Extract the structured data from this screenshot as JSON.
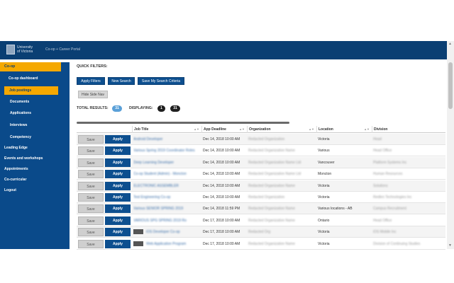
{
  "header": {
    "logo_line1": "University",
    "logo_line2": "of Victoria",
    "portal": "Co-op + Career Portal"
  },
  "sidebar": {
    "top": "Co-op",
    "subs": [
      "Co-op dashboard",
      "Job postings",
      "Documents",
      "Applications",
      "Interviews",
      "Competency"
    ],
    "items": [
      "Leading Edge",
      "Events and workshops",
      "Appointments",
      "Co-curricular",
      "Logout"
    ]
  },
  "filters": {
    "label": "QUICK FILTERS:",
    "apply": "Apply Filters",
    "new_search": "New Search",
    "save_criteria": "Save My Search Criteria",
    "hide_nav": "Hide Side Nav"
  },
  "totals": {
    "total_label": "TOTAL RESULTS:",
    "total_value": "31",
    "displaying_label": "DISPLAYING:",
    "displaying_from": "1",
    "displaying_to": "31"
  },
  "table": {
    "headers": [
      "Job Title",
      "App Deadline",
      "Organization",
      "Location",
      "Division"
    ],
    "save_label": "Save",
    "apply_label": "Apply",
    "rows": [
      {
        "title": "Android Developer",
        "deadline": "Dec 14, 2018 10:00 AM",
        "org": "Redacted Organization",
        "location": "Victoria",
        "division": "Head"
      },
      {
        "title": "Various Spring 2019 Coordinator Roles",
        "deadline": "Dec 14, 2018 10:00 AM",
        "org": "Redacted Organization Name",
        "location": "Various",
        "division": "Head Office"
      },
      {
        "title": "Deep Learning Developer",
        "deadline": "Dec 14, 2018 10:00 AM",
        "org": "Redacted Organization Name Ltd",
        "location": "Vancouver",
        "division": "Platform Systems Inc"
      },
      {
        "title": "Co-op Student (Admin) - Moncton",
        "deadline": "Dec 14, 2018 10:00 AM",
        "org": "Redacted Organization Name Ltd",
        "location": "Moncton",
        "division": "Human Resources"
      },
      {
        "title": "ELECTRONIC ASSEMBLER",
        "deadline": "Dec 14, 2018 10:00 AM",
        "org": "Redacted Organization Name",
        "location": "Victoria",
        "division": "Solutions"
      },
      {
        "title": "Test Engineering Co-op",
        "deadline": "Dec 14, 2018 10:00 AM",
        "org": "Redacted Organization",
        "location": "Victoria",
        "division": "Redlen Technologies Inc"
      },
      {
        "title": "Various SENIOR SPRING 2019",
        "deadline": "Dec 14, 2018 11:59 PM",
        "org": "Redacted Organization Name",
        "location": "Various locations - AB",
        "division": "Campus Recruitment"
      },
      {
        "title": "VARIOUS SPG SPRING 2019 Ro",
        "deadline": "Dec 17, 2018 10:00 AM",
        "org": "Redacted Organization Name",
        "location": "Ontario",
        "division": "Head Office"
      },
      {
        "title": "iOS Developer Co-op",
        "deadline": "Dec 17, 2018 10:00 AM",
        "org": "Redacted Org",
        "location": "Victoria",
        "division": "iOS Mobile Inc"
      },
      {
        "title": "Web Application Program",
        "deadline": "Dec 17, 2018 10:00 AM",
        "org": "Redacted Organization Name",
        "location": "Victoria",
        "division": "Division of Continuing Studies"
      }
    ]
  }
}
